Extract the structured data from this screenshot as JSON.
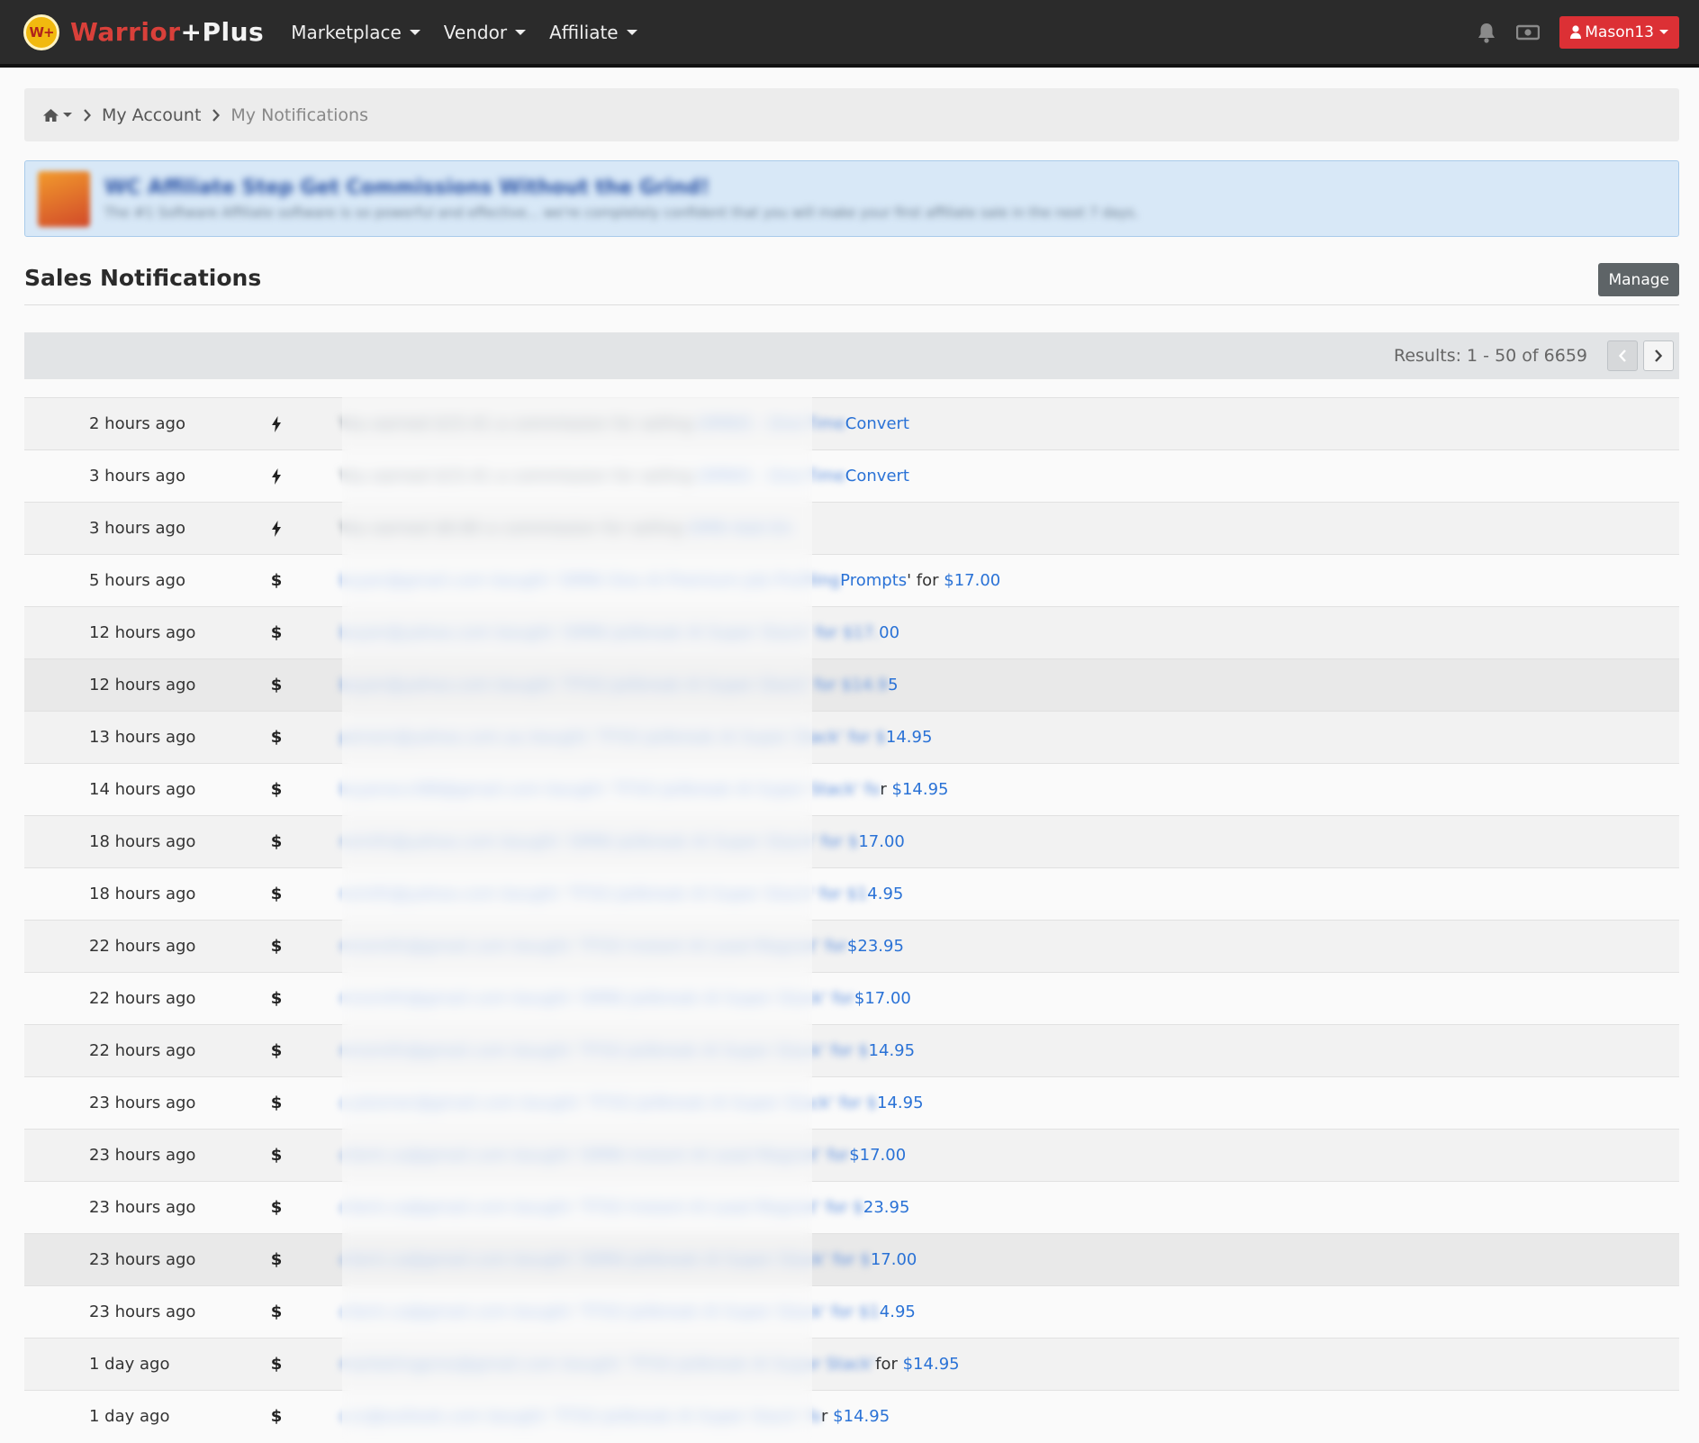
{
  "nav": {
    "brand_a": "Warrior",
    "brand_b": "+Plus",
    "logo_text": "W+",
    "menu": [
      {
        "label": "Marketplace"
      },
      {
        "label": "Vendor"
      },
      {
        "label": "Affiliate"
      }
    ],
    "user": "Mason13"
  },
  "breadcrumb": {
    "account": "My Account",
    "current": "My Notifications"
  },
  "promo": {
    "title": "WC Affiliate Step Get Commissions Without the Grind!",
    "subtitle": "The #1 Software Affiliate software is so powerful and effective... we're completely confident that you will make your first affiliate sale in the next 7 days."
  },
  "section": {
    "title": "Sales Notifications",
    "manage_label": "Manage"
  },
  "results": {
    "text": "Results: 1 - 50 of 6659"
  },
  "rows": [
    {
      "time": "2 hours ago",
      "icon": "bolt",
      "blur": "You earned $15.41 a commission for selling ",
      "blur_link": "OMNI5 - One-Time ",
      "tail_pre": "",
      "tail_link": "Convert"
    },
    {
      "time": "3 hours ago",
      "icon": "bolt",
      "blur": "You earned $15.41 a commission for selling ",
      "blur_link": "OMNI5 - One-Time ",
      "tail_pre": "",
      "tail_link": "Convert"
    },
    {
      "time": "3 hours ago",
      "icon": "bolt",
      "blur": "You earned $8.80 a commission for selling ",
      "blur_link": "OMN Add-On",
      "tail_pre": "",
      "tail_link": ""
    },
    {
      "time": "5 hours ago",
      "icon": "dollar",
      "blur": "",
      "blur_link": "buyer@gmail.com bought 'OMNI One AI Premium Job Profiling ",
      "tail_pre": "",
      "tail_link": "Prompts",
      "tail_post": "' for ",
      "price": "$17.00"
    },
    {
      "time": "12 hours ago",
      "icon": "dollar",
      "blur": "",
      "blur_link": "buyer@yahoo.com bought 'OMNI Jailbreak AI Super Stack' for $17.",
      "tail_pre": "",
      "tail_link": "00"
    },
    {
      "time": "12 hours ago",
      "icon": "dollar",
      "blur": "",
      "blur_link": "buyer@yahoo.com bought 'TF5O Jailbreak AI Super Stack' for $14.9",
      "tail_pre": "",
      "tail_link": "5"
    },
    {
      "time": "13 hours ago",
      "icon": "dollar",
      "blur": "",
      "blur_link": "person@yahoo.com.au bought 'TF5O Jailbreak AI Super Stack' for $",
      "tail_pre": "",
      "tail_link": "14.95"
    },
    {
      "time": "14 hours ago",
      "icon": "dollar",
      "blur": "",
      "blur_link": "buyeracct88@gmail.com bought 'TF5O Jailbreak AI Super Stack' fo",
      "tail_pre": "r ",
      "tail_link": "$14.95"
    },
    {
      "time": "18 hours ago",
      "icon": "dollar",
      "blur": "",
      "blur_link": "rsmith@yahoo.com bought 'OMNI Jailbreak AI Super Stack' for $",
      "tail_pre": "",
      "tail_link": "17.00"
    },
    {
      "time": "18 hours ago",
      "icon": "dollar",
      "blur": "",
      "blur_link": "rsmith@yahoo.com bought 'TF5O Jailbreak AI Super Stack' for $1",
      "tail_pre": "",
      "tail_link": "4.95"
    },
    {
      "time": "22 hours ago",
      "icon": "dollar",
      "blur": "",
      "blur_link": "mrsmith@gmail.com bought 'TF5O Instant AI Lead Magnet' for ",
      "tail_pre": "",
      "tail_link": "$23.95"
    },
    {
      "time": "22 hours ago",
      "icon": "dollar",
      "blur": "",
      "blur_link": "mrsmith@gmail.com bought 'OMNI Jailbreak AI Super Stack' for ",
      "tail_pre": "",
      "tail_link": "$17.00"
    },
    {
      "time": "22 hours ago",
      "icon": "dollar",
      "blur": "",
      "blur_link": "mrsmith@gmail.com bought 'TF5O Jailbreak AI Super Stack' for $",
      "tail_pre": "",
      "tail_link": "14.95"
    },
    {
      "time": "23 hours ago",
      "icon": "dollar",
      "blur": "",
      "blur_link": "customer@gmail.com bought 'TF5O Jailbreak AI Super Stack' for $",
      "tail_pre": "",
      "tail_link": "14.95"
    },
    {
      "time": "23 hours ago",
      "icon": "dollar",
      "blur": "",
      "blur_link": "client.ca@gmail.com bought 'OMNI Instant AI Lead Magnet' for ",
      "tail_pre": "",
      "tail_link": "$17.00"
    },
    {
      "time": "23 hours ago",
      "icon": "dollar",
      "blur": "",
      "blur_link": "client.ca@gmail.com bought 'TF5O Instant AI Lead Magnet' for $",
      "tail_pre": "",
      "tail_link": "23.95"
    },
    {
      "time": "23 hours ago",
      "icon": "dollar",
      "blur": "",
      "blur_link": "client.ca@gmail.com bought 'OMNI Jailbreak AI Super Stack' for $",
      "tail_pre": "",
      "tail_link": "17.00"
    },
    {
      "time": "23 hours ago",
      "icon": "dollar",
      "blur": "",
      "blur_link": "client.ca@gmail.com bought 'TF5O Jailbreak AI Super Stack' for $1",
      "tail_pre": "",
      "tail_link": "4.95"
    },
    {
      "time": "1 day ago",
      "icon": "dollar",
      "blur": "",
      "blur_link": "marketingpros@gmail.com bought 'TF5O Jailbreak AI Super Stack' ",
      "tail_pre": "for ",
      "tail_link": "$14.95"
    },
    {
      "time": "1 day ago",
      "icon": "dollar",
      "blur": "",
      "blur_link": "ccx@outlook.com bought 'TF5O Jailbreak AI Super Stack' fo",
      "tail_pre": "r ",
      "tail_link": "$14.95"
    }
  ]
}
